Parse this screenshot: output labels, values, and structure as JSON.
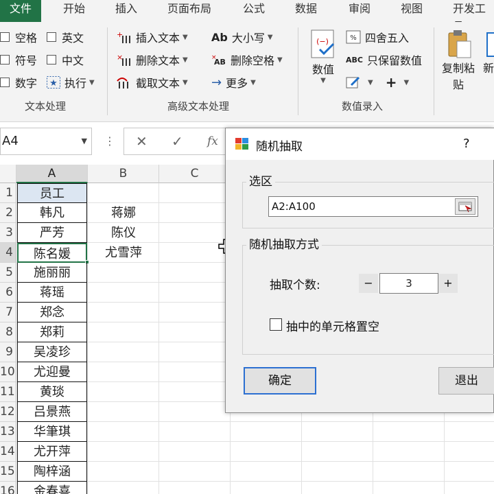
{
  "ribbon": {
    "tabs": [
      "文件",
      "开始",
      "插入",
      "页面布局",
      "公式",
      "数据",
      "审阅",
      "视图",
      "开发工具"
    ],
    "text_group": {
      "checkboxes": [
        "空格",
        "符号",
        "数字"
      ],
      "checkboxes2": [
        "英文",
        "中文"
      ],
      "execute": "执行",
      "label": "文本处理"
    },
    "advanced_group": {
      "insert_text": "插入文本",
      "delete_text": "删除文本",
      "cut_text": "截取文本",
      "case": "大小写",
      "delete_spaces": "删除空格",
      "more": "更多",
      "label": "高级文本处理"
    },
    "number_group": {
      "number": "数值",
      "round": "四舍五入",
      "keep_value": "只保留数值",
      "label": "数值录入"
    },
    "paste_group": {
      "copy_paste_1": "复制粘",
      "copy_paste_2": "贴",
      "new_1": "新"
    }
  },
  "formula_bar": {
    "name_box": "A4",
    "cancel": "✕",
    "confirm": "✓",
    "fx": "fx",
    "colon": "⋮"
  },
  "sheet": {
    "columns": [
      "A",
      "B",
      "C"
    ],
    "row_numbers": [
      "1",
      "2",
      "3",
      "4",
      "5",
      "6",
      "7",
      "8",
      "9",
      "10",
      "11",
      "12",
      "13",
      "14",
      "15",
      "16"
    ],
    "col_a": [
      "员工",
      "韩凡",
      "严芳",
      "陈名媛",
      "施丽丽",
      "蒋瑶",
      "郑念",
      "郑莉",
      "吴凌珍",
      "尤迎曼",
      "黄琰",
      "吕景燕",
      "华筆琪",
      "尤开萍",
      "陶梓涵",
      "金春喜"
    ],
    "col_b": [
      "",
      "蒋娜",
      "陈仪",
      "尤雪萍"
    ],
    "active_cell": "A4"
  },
  "dialog": {
    "title": "随机抽取",
    "help": "?",
    "selection_legend": "选区",
    "range_value": "A2:A100",
    "method_legend": "随机抽取方式",
    "count_label": "抽取个数:",
    "count_minus": "−",
    "count_value": "3",
    "count_plus": "+",
    "clear_checkbox_label": "抽中的单元格置空",
    "clear_checked": false,
    "ok_button": "确定",
    "exit_button": "退出"
  },
  "colors": {
    "excel_green": "#217346",
    "header_fill": "#dce6f2",
    "dialog_bg": "#f0f0f0",
    "primary_border": "#2b6fd1"
  }
}
